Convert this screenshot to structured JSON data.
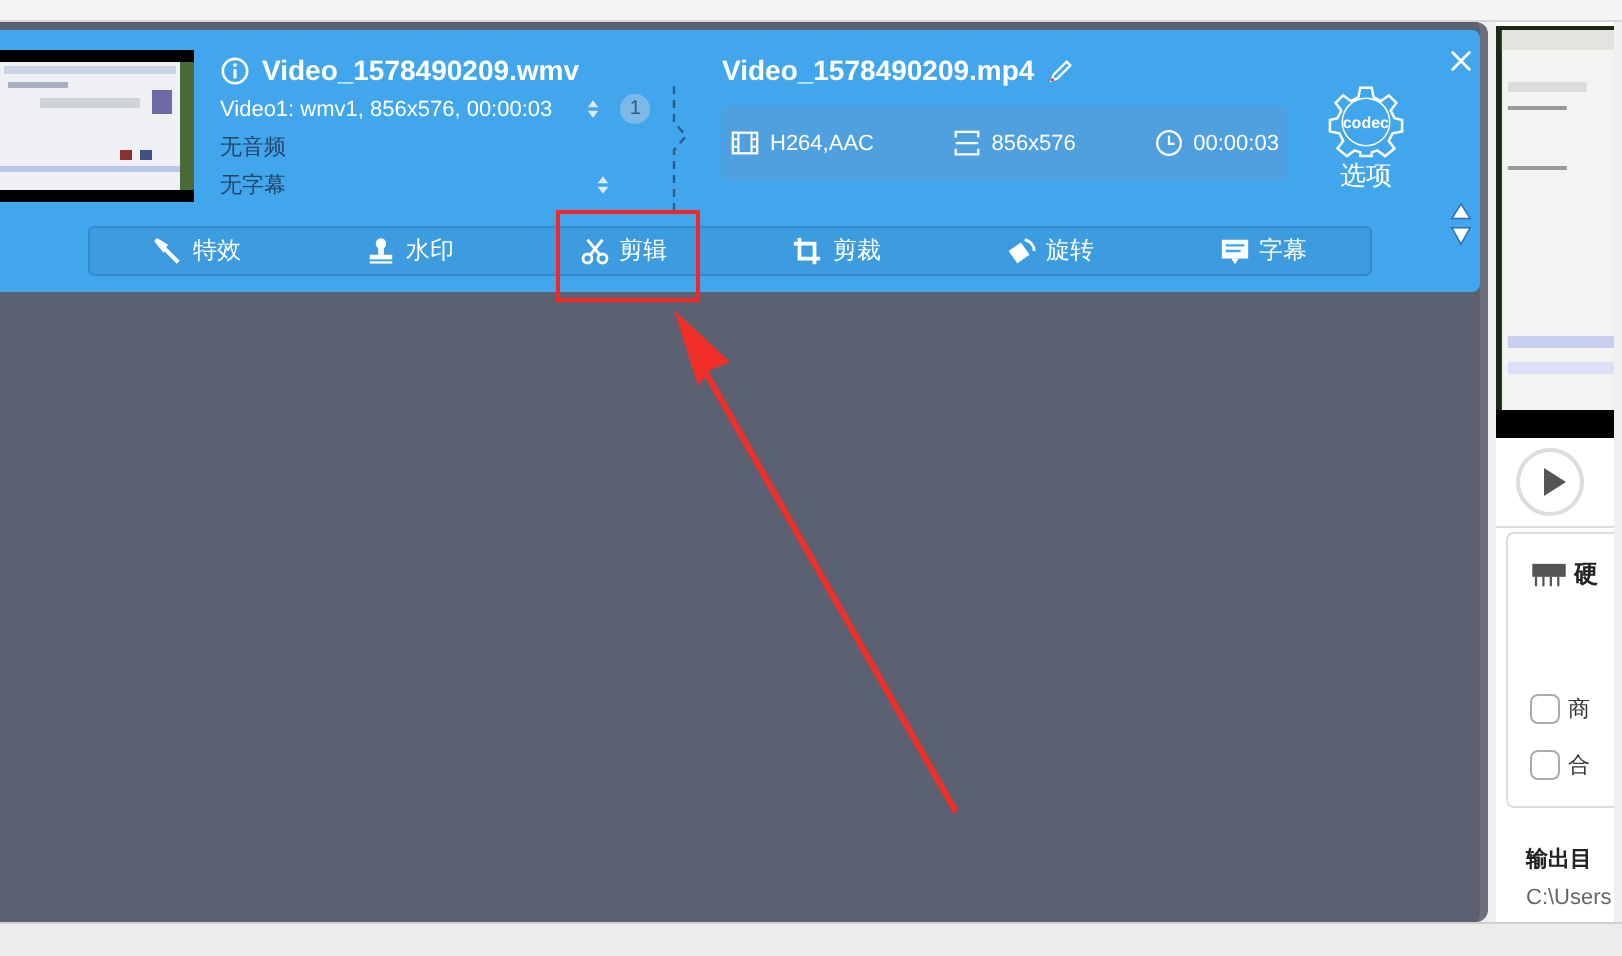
{
  "source": {
    "title": "Video_1578490209.wmv",
    "video_stream": "Video1: wmv1, 856x576, 00:00:03",
    "stream_count": "1",
    "audio": "无音频",
    "subtitle": "无字幕"
  },
  "output": {
    "title": "Video_1578490209.mp4",
    "codec": "H264,AAC",
    "resolution": "856x576",
    "duration": "00:00:03"
  },
  "codec_button": {
    "icon_text": "codec",
    "label": "选项"
  },
  "toolbar": [
    {
      "kind": "effects",
      "label": "特效",
      "highlighted": false
    },
    {
      "kind": "watermark",
      "label": "水印",
      "highlighted": false
    },
    {
      "kind": "cut",
      "label": "剪辑",
      "highlighted": true
    },
    {
      "kind": "crop",
      "label": "剪裁",
      "highlighted": false
    },
    {
      "kind": "rotate",
      "label": "旋转",
      "highlighted": false
    },
    {
      "kind": "subtitle",
      "label": "字幕",
      "highlighted": false
    }
  ],
  "side_panel": {
    "section_title": "硬",
    "options": [
      {
        "label": "商",
        "checked": false
      },
      {
        "label": "合",
        "checked": false
      }
    ],
    "output_dir_label": "输出目",
    "output_dir": "C:\\Users"
  }
}
